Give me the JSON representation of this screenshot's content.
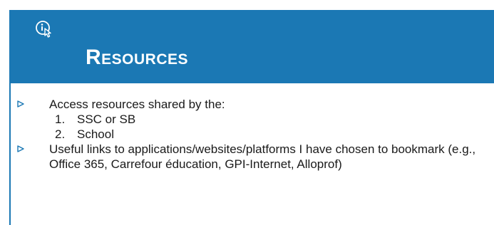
{
  "slide": {
    "title": "Resources",
    "header_color": "#1b78b4",
    "icon": "info-pointer-icon",
    "items": [
      {
        "text": "Access resources shared by the:",
        "subitems": [
          {
            "number": "1.",
            "text": "SSC or SB"
          },
          {
            "number": "2.",
            "text": "School"
          }
        ]
      },
      {
        "text": "Useful links to applications/websites/platforms I have chosen to bookmark (e.g., Office 365, Carrefour éducation, GPI-Internet, Alloprof)"
      }
    ]
  }
}
